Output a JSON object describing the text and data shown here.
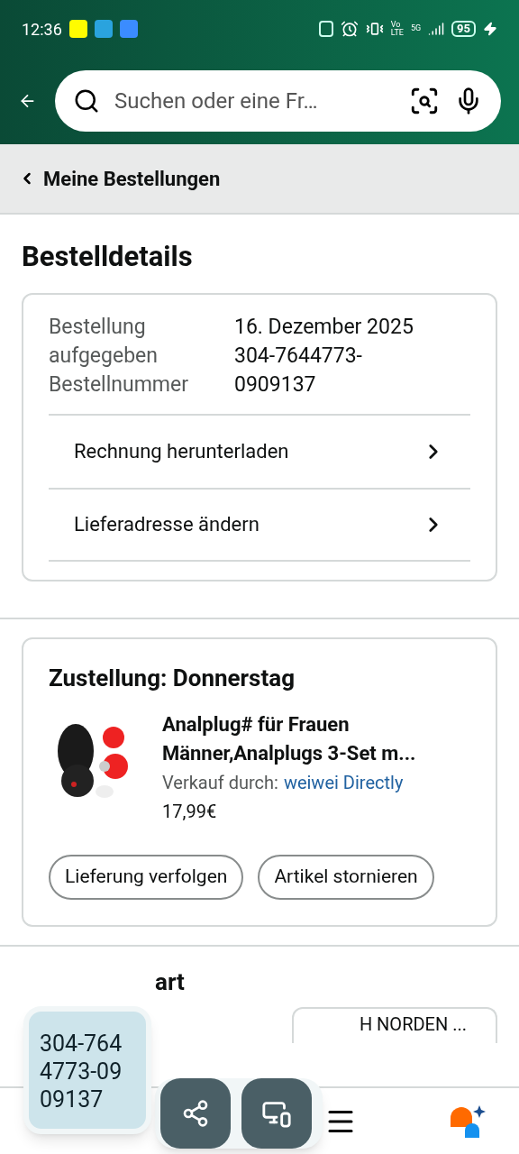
{
  "status_bar": {
    "time": "12:36",
    "battery": "95",
    "network_top": "Vo",
    "network_bottom": "LTE",
    "band": "5G"
  },
  "search": {
    "placeholder": "Suchen oder eine Fr…"
  },
  "breadcrumb": {
    "label": "Meine Bestellungen"
  },
  "page_title": "Bestelldetails",
  "order": {
    "rows": [
      {
        "label": "Bestellung aufgegeben",
        "value": "16. Dezember 2025"
      },
      {
        "label": "Bestellnummer",
        "value": "304-7644773-0909137"
      }
    ],
    "links": [
      "Rechnung herunterladen",
      "Lieferadresse ändern"
    ]
  },
  "shipment": {
    "title": "Zustellung: Donnerstag",
    "item": {
      "kind": "picture",
      "title": "Analplug# für Frauen Männer,Analplugs 3-Set m...",
      "seller_label": "Verkauf durch:",
      "seller": "weiwei Directly",
      "price": "17,99€"
    },
    "buttons": [
      "Lieferung verfolgen",
      "Artikel stornieren"
    ]
  },
  "next_section": {
    "title": "art",
    "address": "H NORDEN ..."
  },
  "overlay": {
    "clip_text": "304-764 4773-09 09137"
  }
}
